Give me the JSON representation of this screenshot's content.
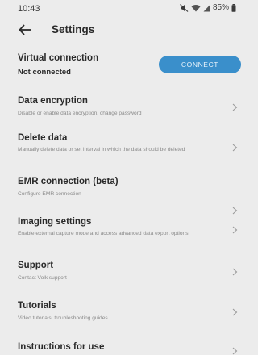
{
  "status_bar": {
    "time": "10:43",
    "battery": "85%"
  },
  "header": {
    "title": "Settings"
  },
  "virtual_connection": {
    "title": "Virtual connection",
    "status": "Not connected",
    "button_label": "CONNECT"
  },
  "settings": [
    {
      "title": "Data encryption",
      "description": "Disable or enable data encryption, change password"
    },
    {
      "title": "Delete data",
      "description": "Manually delete data or set interval in which the data should be deleted"
    },
    {
      "title": "EMR connection (beta)",
      "description": "Configure EMR connection"
    },
    {
      "title": "Imaging settings",
      "description": "Enable external capture mode and access advanced data export options"
    },
    {
      "title": "Support",
      "description": "Contact Volk support"
    },
    {
      "title": "Tutorials",
      "description": "Video tutorials, troubleshooting guides"
    },
    {
      "title": "Instructions for use",
      "description": ""
    }
  ],
  "colors": {
    "background": "#ececec",
    "accent": "#3a8fcb"
  },
  "icons": {
    "back": "back-arrow-icon",
    "chevron": "chevron-right-icon",
    "mute": "mute-icon",
    "wifi": "wifi-icon",
    "signal": "signal-icon",
    "battery": "battery-icon"
  }
}
